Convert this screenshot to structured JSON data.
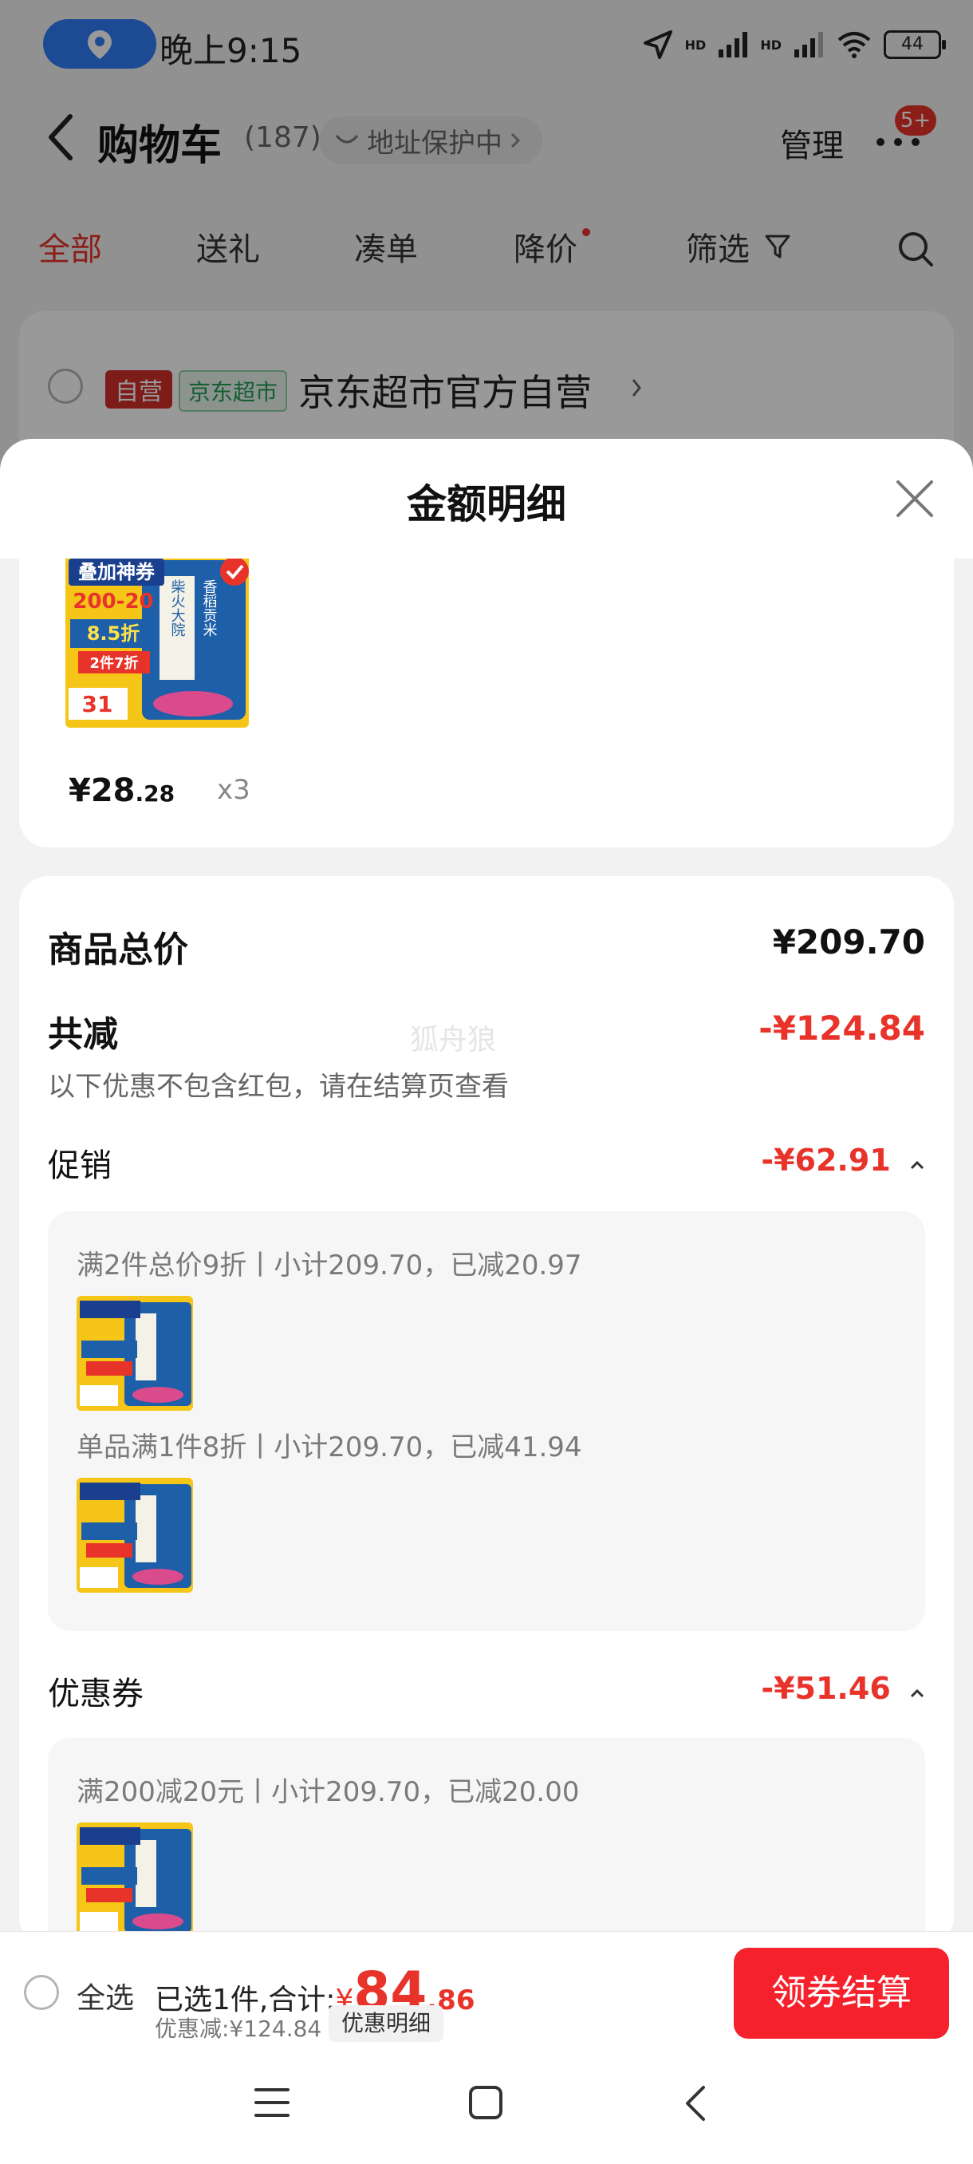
{
  "status_bar": {
    "time": "晚上9:15",
    "battery": "44",
    "network_1": "HD",
    "network_2": "HD"
  },
  "header": {
    "title": "购物车",
    "count": "(187)",
    "address_label": "地址保护中",
    "manage_label": "管理",
    "more_badge": "5+"
  },
  "tabs": [
    {
      "label": "全部",
      "active": true
    },
    {
      "label": "送礼"
    },
    {
      "label": "凑单"
    },
    {
      "label": "降价"
    },
    {
      "label": "筛选"
    }
  ],
  "store": {
    "tag_self": "自营",
    "tag_market": "京东超市",
    "name": "京东超市官方自营"
  },
  "sheet": {
    "title": "金额明细",
    "product": {
      "price_main": "¥28",
      "price_decimal": ".28",
      "quantity": "x3"
    },
    "total_label": "商品总价",
    "total_value": "¥209.70",
    "reduce_label": "共减",
    "reduce_value": "-¥124.84",
    "reduce_note": "以下优惠不包含红包，请在结算页查看",
    "watermark": "狐舟狼",
    "promo_label": "促销",
    "promo_value": "-¥62.91",
    "promo_items": [
      "满2件总价9折丨小计209.70，已减20.97",
      "单品满1件8折丨小计209.70，已减41.94"
    ],
    "coupon_label": "优惠券",
    "coupon_value": "-¥51.46",
    "coupon_items": [
      "满200减20元丨小计209.70，已减20.00"
    ]
  },
  "product_image_text": {
    "banner": "叠加神券",
    "offer": "200-20",
    "discount": "8.5折",
    "deal": "2件7折",
    "price": "31",
    "brand": "柴火大院",
    "rice": "香稻贡米"
  },
  "bottom_bar": {
    "select_all_label": "全选",
    "selected_text": "已选1件,合计:",
    "currency": "¥",
    "total_big": "84",
    "total_small": ".86",
    "discount_text": "优惠减:¥124.84",
    "detail_label": "优惠明细",
    "checkout_label": "领券结算"
  },
  "colors": {
    "accent_red": "#e8332a",
    "checkout_red": "#f5222d",
    "location_blue": "#2f7df6"
  }
}
